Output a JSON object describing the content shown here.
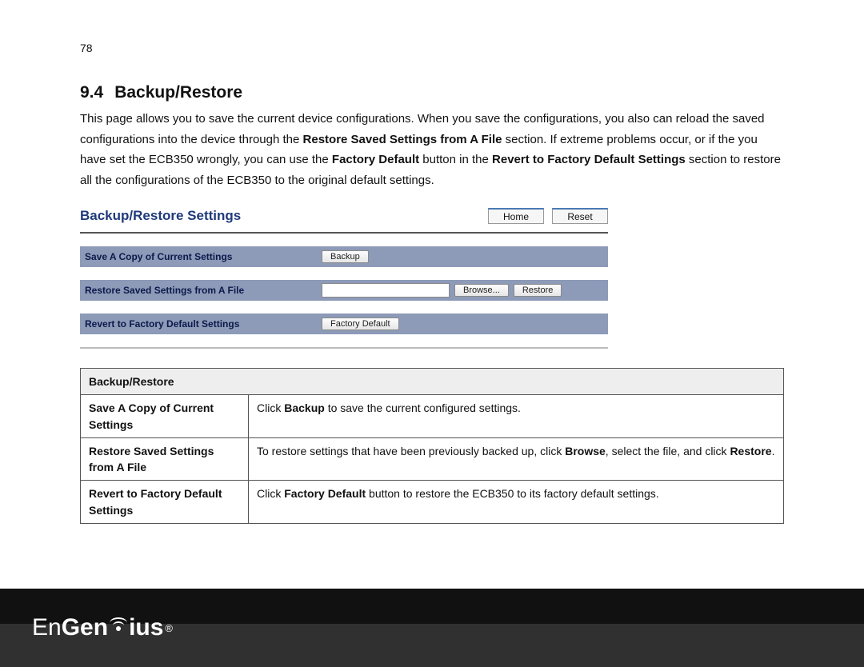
{
  "page_number": "78",
  "section_number": "9.4",
  "section_title": "Backup/Restore",
  "intro": {
    "t1": "This page allows you to save the current device configurations. When you save the configurations, you also can reload the saved configurations into the device through the ",
    "b1": "Restore Saved Settings from A File",
    "t2": " section. If extreme problems occur, or if the you have set the ECB350 wrongly, you can use the ",
    "b2": "Factory Default",
    "t3": " button in the ",
    "b3": "Revert to Factory Default Settings",
    "t4": " section to restore all the configurations of the ECB350 to the original default settings."
  },
  "screenshot": {
    "title": "Backup/Restore Settings",
    "home": "Home",
    "reset": "Reset",
    "rows": {
      "save_label": "Save A Copy of Current Settings",
      "backup_btn": "Backup",
      "restore_label": "Restore Saved Settings from A File",
      "browse_btn": "Browse...",
      "restore_btn": "Restore",
      "revert_label": "Revert to Factory Default Settings",
      "factory_btn": "Factory Default"
    }
  },
  "table": {
    "header": "Backup/Restore",
    "r1": {
      "key": "Save A Copy of Current Settings",
      "a": "Click ",
      "b": "Backup",
      "c": " to save the current configured settings."
    },
    "r2": {
      "key": "Restore Saved Settings from A File",
      "a": "To restore settings that have been previously backed up, click ",
      "b": "Browse",
      "c": ", select the file, and click ",
      "d": "Restore",
      "e": "."
    },
    "r3": {
      "key": "Revert to Factory Default Settings",
      "a": "Click ",
      "b": "Factory Default",
      "c": " button to restore the ECB350 to its factory default settings."
    }
  },
  "brand": {
    "part1": "En",
    "part2": "Gen",
    "part3": "ius",
    "reg": "®"
  }
}
